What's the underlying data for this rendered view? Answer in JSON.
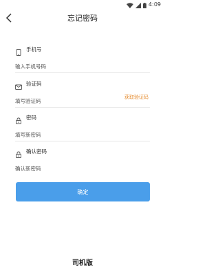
{
  "status_bar": {
    "time": "4:09"
  },
  "header": {
    "title": "忘记密码"
  },
  "fields": [
    {
      "label": "手机号",
      "placeholder": "输入手机号码"
    },
    {
      "label": "验证码",
      "placeholder": "填写验证码",
      "action": "获取验证码"
    },
    {
      "label": "密码",
      "placeholder": "填写新密码"
    },
    {
      "label": "确认密码",
      "placeholder": "确认新密码"
    }
  ],
  "confirm_label": "确定",
  "footer": {
    "text": "司机版"
  },
  "colors": {
    "primary": "#4a9eea",
    "link": "#e58a2b"
  },
  "icons": [
    "back-arrow-icon",
    "phone-icon",
    "mail-icon",
    "lock-icon"
  ]
}
